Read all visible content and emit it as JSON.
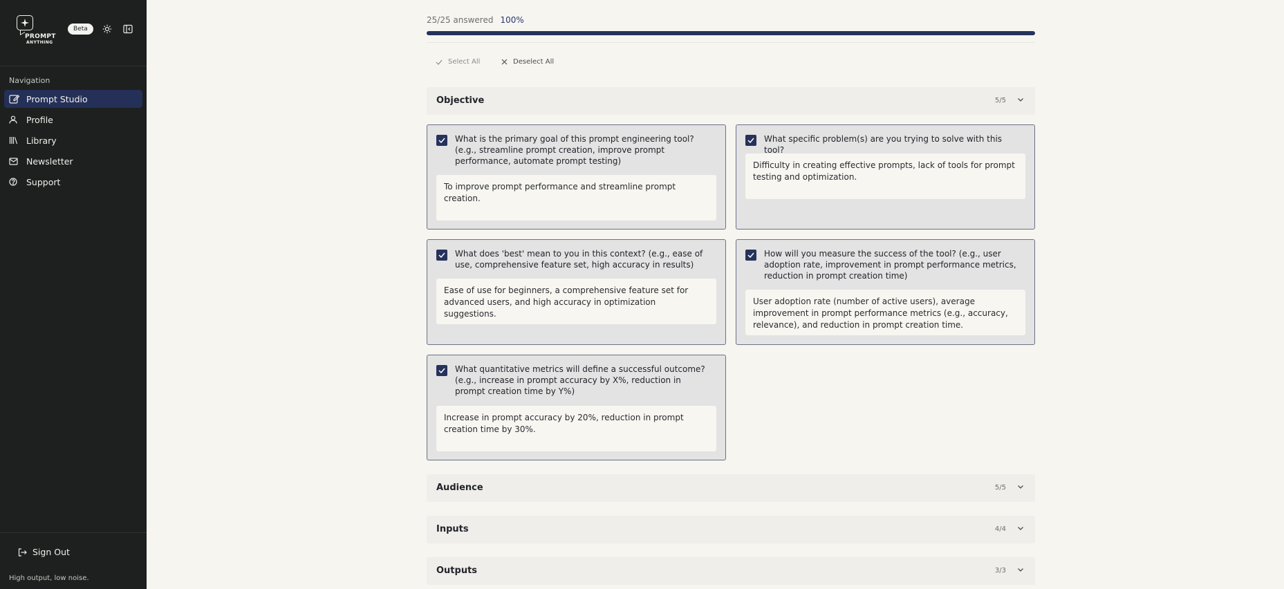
{
  "brand": {
    "name_line1": "PROMPT",
    "name_line2": "ANYTHING",
    "badge": "Beta"
  },
  "sidebar": {
    "nav_heading": "Navigation",
    "items": [
      {
        "label": "Prompt Studio",
        "icon": "edit-icon",
        "active": true
      },
      {
        "label": "Profile",
        "icon": "user-icon"
      },
      {
        "label": "Library",
        "icon": "library-icon"
      },
      {
        "label": "Newsletter",
        "icon": "mail-icon"
      },
      {
        "label": "Support",
        "icon": "help-circle-icon"
      }
    ],
    "sign_out": "Sign Out",
    "tagline": "High output, low noise."
  },
  "progress": {
    "answered_text": "25/25 answered",
    "percent_text": "100%",
    "fraction": 1.0
  },
  "selection": {
    "select_all": "Select All",
    "deselect_all": "Deselect All"
  },
  "sections": [
    {
      "title": "Objective",
      "count": "5/5",
      "expanded": true,
      "questions": [
        {
          "checked": true,
          "question": "What is the primary goal of this prompt engineering tool? (e.g., streamline prompt creation, improve prompt performance, automate prompt testing)",
          "answer": "To improve prompt performance and streamline prompt creation."
        },
        {
          "checked": true,
          "question": "What specific problem(s) are you trying to solve with this tool?",
          "answer": "Difficulty in creating effective prompts, lack of tools for prompt testing and optimization."
        },
        {
          "checked": true,
          "question": "What does 'best' mean to you in this context? (e.g., ease of use, comprehensive feature set, high accuracy in results)",
          "answer": "Ease of use for beginners, a comprehensive feature set for advanced users, and high accuracy in optimization suggestions."
        },
        {
          "checked": true,
          "question": "How will you measure the success of the tool? (e.g., user adoption rate, improvement in prompt performance metrics, reduction in prompt creation time)",
          "answer": "User adoption rate (number of active users), average improvement in prompt performance metrics (e.g., accuracy, relevance), and reduction in prompt creation time."
        },
        {
          "checked": true,
          "question": "What quantitative metrics will define a successful outcome? (e.g., increase in prompt accuracy by X%, reduction in prompt creation time by Y%)",
          "answer": "Increase in prompt accuracy by 20%, reduction in prompt creation time by 30%."
        }
      ]
    },
    {
      "title": "Audience",
      "count": "5/5",
      "expanded": false
    },
    {
      "title": "Inputs",
      "count": "4/4",
      "expanded": false
    },
    {
      "title": "Outputs",
      "count": "3/3",
      "expanded": false
    }
  ],
  "colors": {
    "sidebar_bg": "#1d201e",
    "accent": "#26325c",
    "nav_active_bg": "#243057",
    "page_bg": "#f6f5f0",
    "card_bg": "#e3e3e3"
  }
}
